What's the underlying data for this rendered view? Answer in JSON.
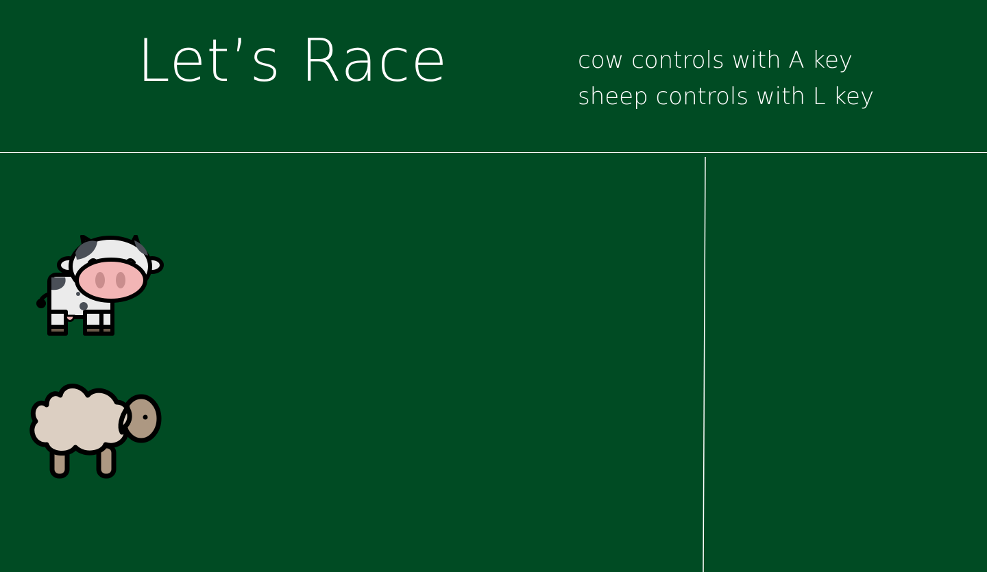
{
  "header": {
    "title": "Let’s Race",
    "controls": [
      "cow controls with A key",
      "sheep controls with L key"
    ]
  },
  "colors": {
    "background": "#004b23",
    "line": "#ffffff",
    "cow_body": "#ebebeb",
    "cow_spots": "#4a4f57",
    "cow_nose": "#f2b5b5",
    "cow_nostril": "#c98d8d",
    "cow_hoof": "#6b5a4a",
    "sheep_wool": "#dccfc2",
    "sheep_face": "#ad9882",
    "sheep_legs": "#ad9882",
    "outline": "#000000"
  },
  "racers": [
    {
      "name": "cow",
      "icon": "cow-icon"
    },
    {
      "name": "sheep",
      "icon": "sheep-icon"
    }
  ]
}
